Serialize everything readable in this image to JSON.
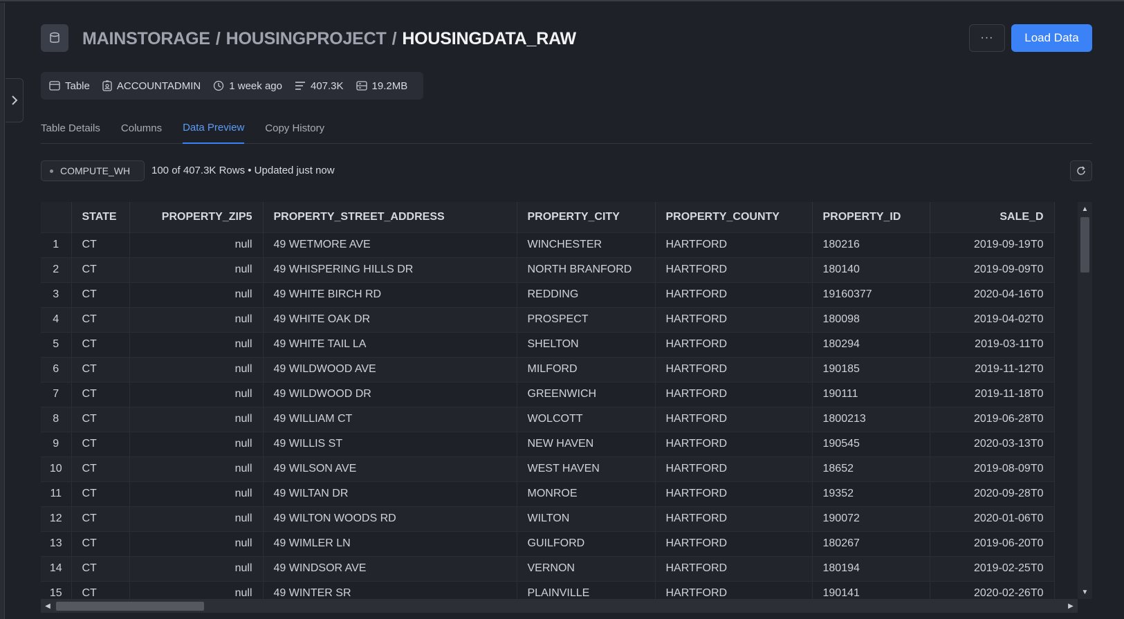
{
  "breadcrumb": {
    "database": "MAINSTORAGE",
    "schema": "HOUSINGPROJECT",
    "separator": "/",
    "table": "HOUSINGDATA_RAW"
  },
  "header": {
    "more_label": "···",
    "load_button": "Load Data"
  },
  "meta": {
    "type": "Table",
    "owner": "ACCOUNTADMIN",
    "modified": "1 week ago",
    "rows": "407.3K",
    "size": "19.2MB"
  },
  "tabs": [
    {
      "label": "Table Details",
      "active": false
    },
    {
      "label": "Columns",
      "active": false
    },
    {
      "label": "Data Preview",
      "active": true
    },
    {
      "label": "Copy History",
      "active": false
    }
  ],
  "toolbar": {
    "warehouse": "COMPUTE_WH",
    "rows_info": "100 of 407.3K Rows • Updated just now"
  },
  "table": {
    "columns": [
      "",
      "STATE",
      "PROPERTY_ZIP5",
      "PROPERTY_STREET_ADDRESS",
      "PROPERTY_CITY",
      "PROPERTY_COUNTY",
      "PROPERTY_ID",
      "SALE_D"
    ],
    "rows": [
      [
        "1",
        "CT",
        "null",
        "49 WETMORE AVE",
        "WINCHESTER",
        "HARTFORD",
        "180216",
        "2019-09-19T0"
      ],
      [
        "2",
        "CT",
        "null",
        "49 WHISPERING HILLS DR",
        "NORTH BRANFORD",
        "HARTFORD",
        "180140",
        "2019-09-09T0"
      ],
      [
        "3",
        "CT",
        "null",
        "49 WHITE BIRCH RD",
        "REDDING",
        "HARTFORD",
        "19160377",
        "2020-04-16T0"
      ],
      [
        "4",
        "CT",
        "null",
        "49 WHITE OAK DR",
        "PROSPECT",
        "HARTFORD",
        "180098",
        "2019-04-02T0"
      ],
      [
        "5",
        "CT",
        "null",
        "49 WHITE TAIL LA",
        "SHELTON",
        "HARTFORD",
        "180294",
        "2019-03-11T0"
      ],
      [
        "6",
        "CT",
        "null",
        "49 WILDWOOD AVE",
        "MILFORD",
        "HARTFORD",
        "190185",
        "2019-11-12T0"
      ],
      [
        "7",
        "CT",
        "null",
        "49 WILDWOOD DR",
        "GREENWICH",
        "HARTFORD",
        "190111",
        "2019-11-18T0"
      ],
      [
        "8",
        "CT",
        "null",
        "49 WILLIAM CT",
        "WOLCOTT",
        "HARTFORD",
        "1800213",
        "2019-06-28T0"
      ],
      [
        "9",
        "CT",
        "null",
        "49 WILLIS ST",
        "NEW HAVEN",
        "HARTFORD",
        "190545",
        "2020-03-13T0"
      ],
      [
        "10",
        "CT",
        "null",
        "49 WILSON AVE",
        "WEST HAVEN",
        "HARTFORD",
        "18652",
        "2019-08-09T0"
      ],
      [
        "11",
        "CT",
        "null",
        "49 WILTAN DR",
        "MONROE",
        "HARTFORD",
        "19352",
        "2020-09-28T0"
      ],
      [
        "12",
        "CT",
        "null",
        "49 WILTON WOODS RD",
        "WILTON",
        "HARTFORD",
        "190072",
        "2020-01-06T0"
      ],
      [
        "13",
        "CT",
        "null",
        "49 WIMLER LN",
        "GUILFORD",
        "HARTFORD",
        "180267",
        "2019-06-20T0"
      ],
      [
        "14",
        "CT",
        "null",
        "49 WINDSOR AVE",
        "VERNON",
        "HARTFORD",
        "180194",
        "2019-02-25T0"
      ],
      [
        "15",
        "CT",
        "null",
        "49 WINTER SR",
        "PLAINVILLE",
        "HARTFORD",
        "190141",
        "2020-02-26T0"
      ]
    ]
  },
  "colors": {
    "accent": "#3b82f6",
    "background": "#1f2128"
  }
}
